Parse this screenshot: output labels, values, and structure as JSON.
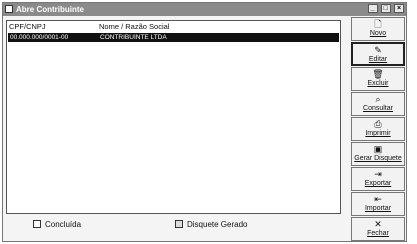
{
  "window": {
    "title": "Abre Contribuinte",
    "buttons": {
      "minimize": "_",
      "maximize": "□",
      "close": "×"
    }
  },
  "list": {
    "columns": [
      "CPF/CNPJ",
      "Nome / Razão Social"
    ],
    "rows": [
      {
        "id": "00.000.000/0001-00",
        "name": "CONTRIBUINTE LTDA"
      }
    ]
  },
  "actions": [
    {
      "label": "Novo",
      "icon": "new-doc-icon"
    },
    {
      "label": "Editar",
      "icon": "edit-icon"
    },
    {
      "label": "Excluir",
      "icon": "trash-icon"
    },
    {
      "label": "Consultar",
      "icon": "search-icon"
    },
    {
      "label": "Imprimir",
      "icon": "printer-icon"
    },
    {
      "label": "Gerar Disquete",
      "icon": "disk-icon"
    },
    {
      "label": "Exportar",
      "icon": "export-icon"
    },
    {
      "label": "Importar",
      "icon": "import-icon"
    },
    {
      "label": "Fechar",
      "icon": "close-icon"
    }
  ],
  "legend": [
    {
      "label": "Concluída"
    },
    {
      "label": "Disquete Gerado"
    }
  ]
}
